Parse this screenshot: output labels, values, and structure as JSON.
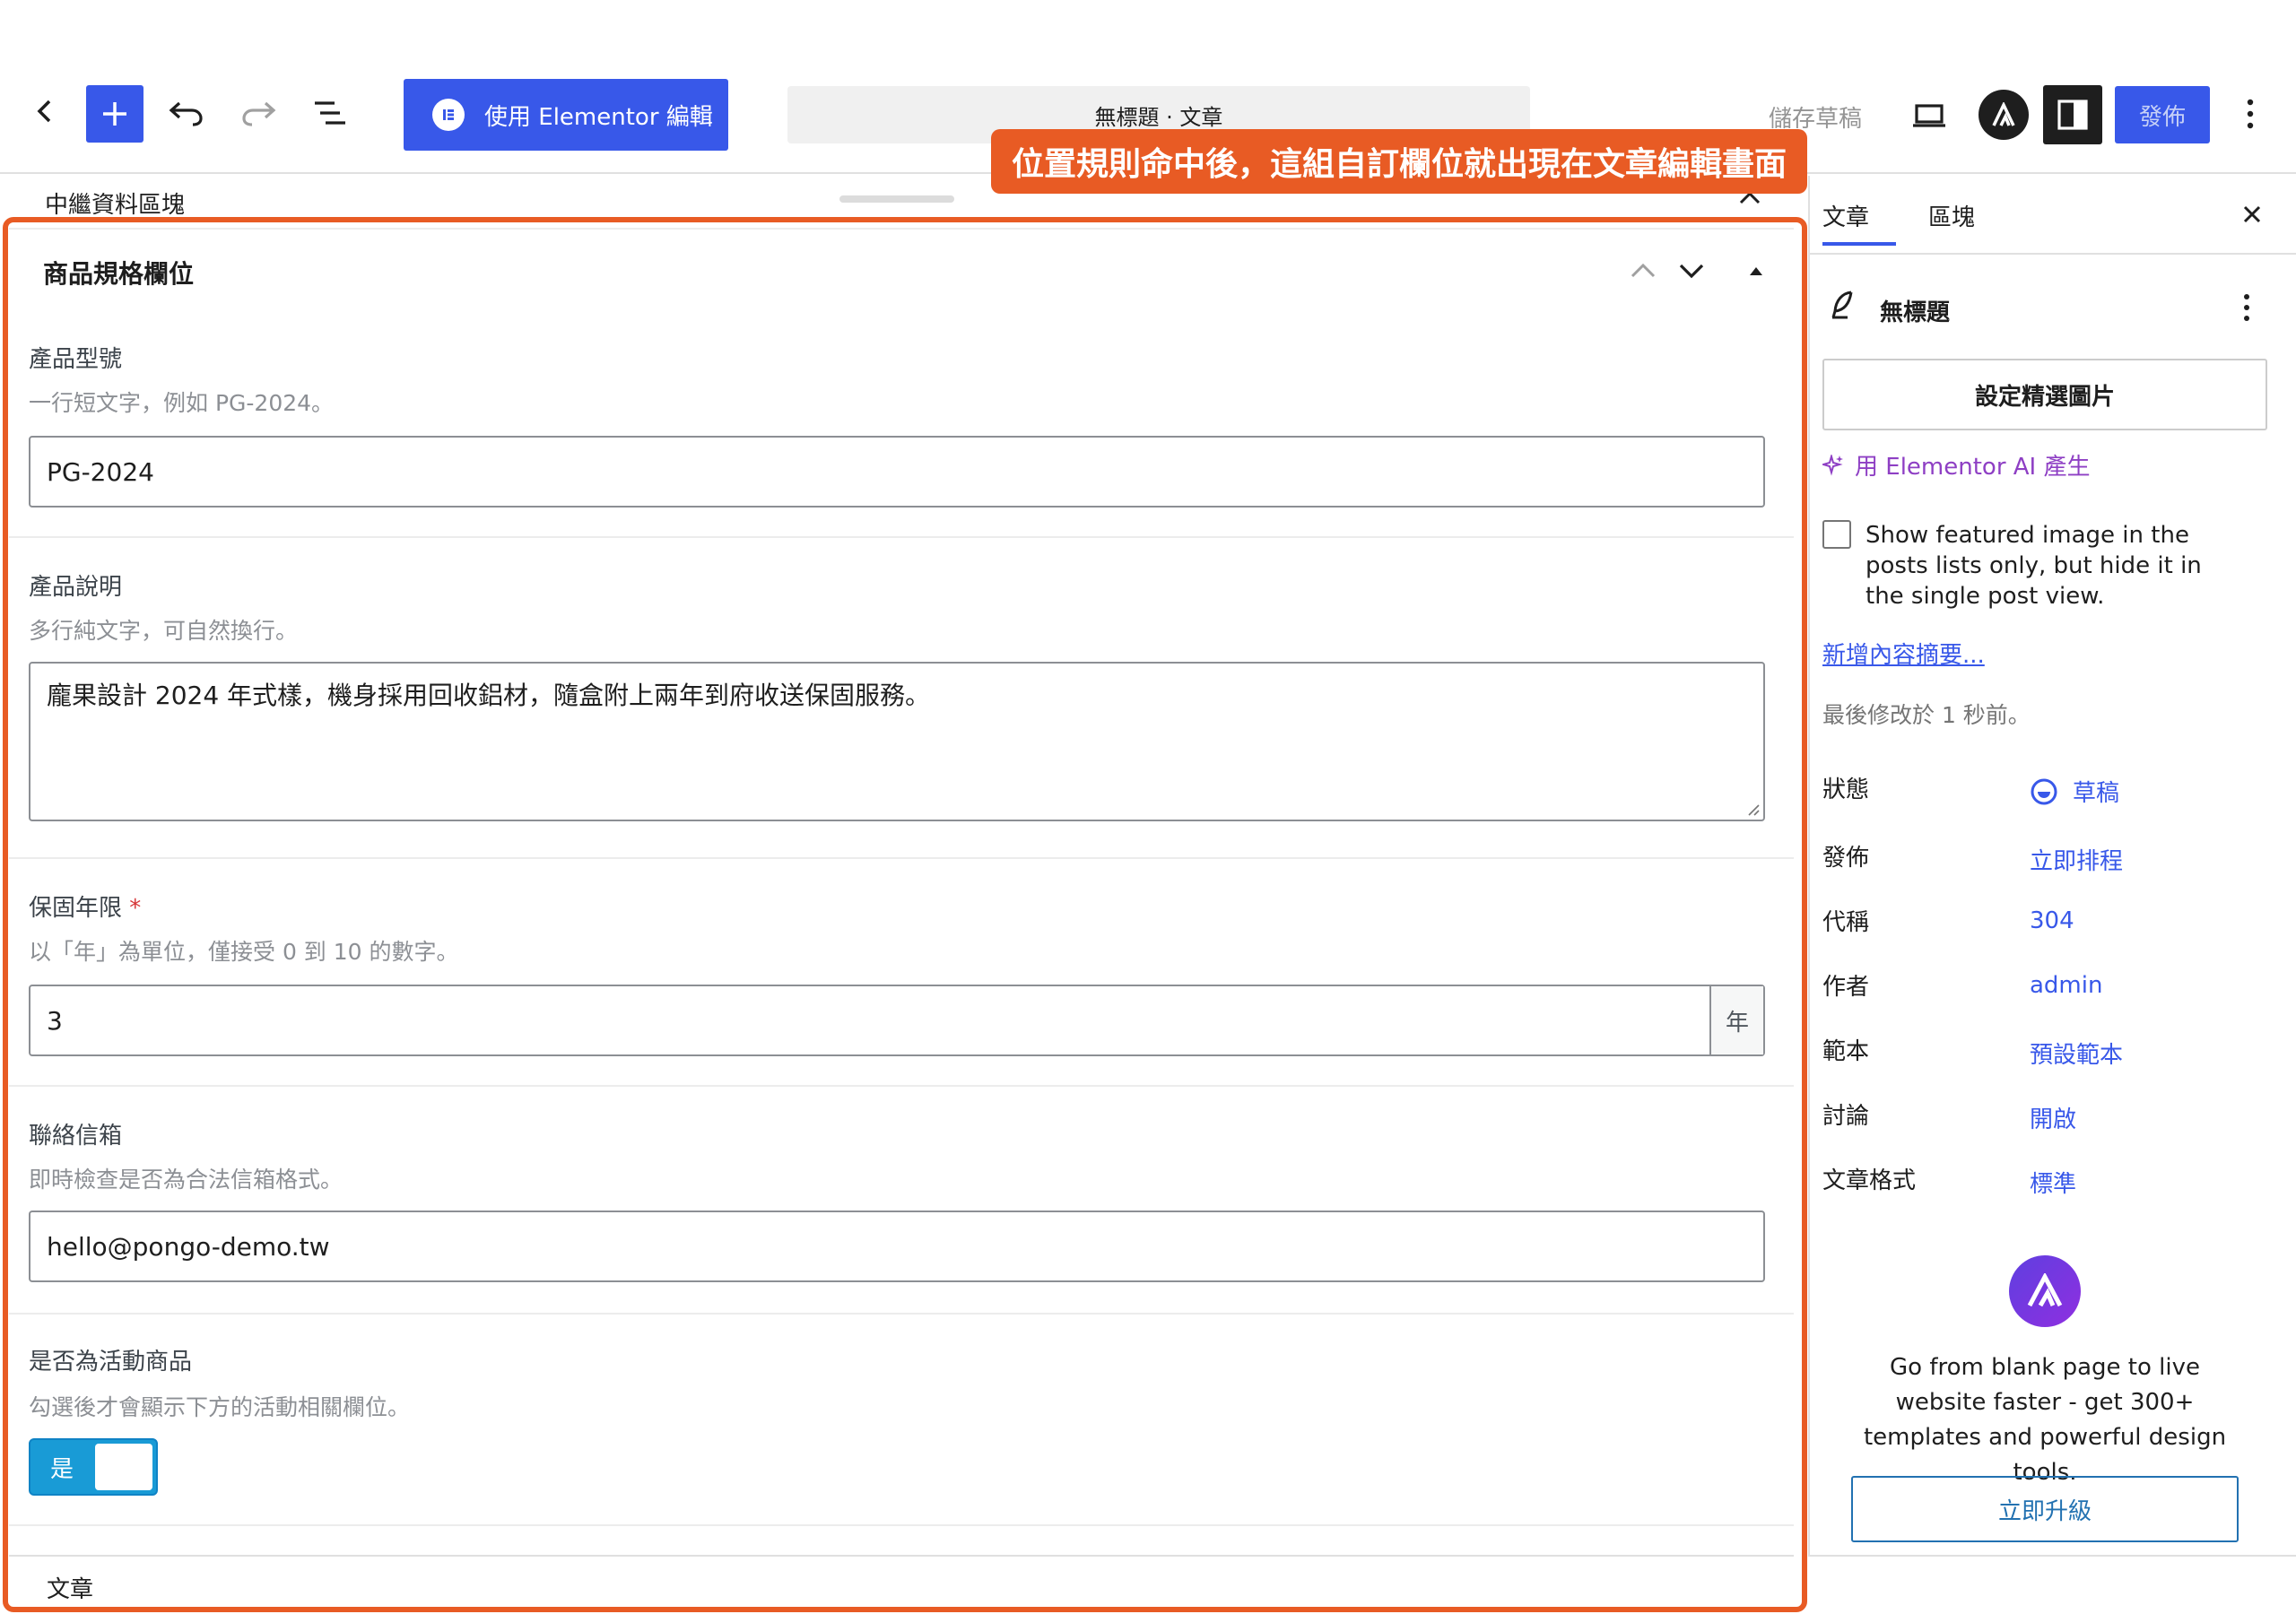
{
  "toolbar": {
    "elementor_button": "使用 Elementor 編輯",
    "document_title": "無標題 · 文章",
    "save_draft": "儲存草稿",
    "publish": "發佈"
  },
  "meta": {
    "header_label": "中繼資料區塊",
    "group_title": "商品規格欄位",
    "callout": "位置規則命中後，這組自訂欄位就出現在文章編輯畫面",
    "fields": [
      {
        "label": "產品型號",
        "description": "一行短文字，例如 PG-2024。",
        "value": "PG-2024"
      },
      {
        "label": "產品說明",
        "description": "多行純文字，可自然換行。",
        "value": "龐果設計 2024 年式樣，機身採用回收鋁材，隨盒附上兩年到府收送保固服務。"
      },
      {
        "label": "保固年限",
        "required_mark": "*",
        "description": "以「年」為單位，僅接受 0 到 10 的數字。",
        "value": "3",
        "append": "年"
      },
      {
        "label": "聯絡信箱",
        "description": "即時檢查是否為合法信箱格式。",
        "value": "hello@pongo-demo.tw"
      },
      {
        "label": "是否為活動商品",
        "description": "勾選後才會顯示下方的活動相關欄位。",
        "toggle_label": "是"
      }
    ],
    "bottom_label": "文章"
  },
  "sidebar": {
    "tabs": [
      "文章",
      "區塊"
    ],
    "post_title": "無標題",
    "featured_image_button": "設定精選圖片",
    "ai_link": "用 Elementor AI 產生",
    "checkbox_text": "Show featured image in the posts lists only, but hide it in the single post view.",
    "excerpt_link": "新增內容摘要...",
    "last_modified": "最後修改於 1 秒前。",
    "rows": [
      {
        "label": "狀態",
        "value": "草稿"
      },
      {
        "label": "發佈",
        "value": "立即排程"
      },
      {
        "label": "代稱",
        "value": "304"
      },
      {
        "label": "作者",
        "value": "admin"
      },
      {
        "label": "範本",
        "value": "預設範本"
      },
      {
        "label": "討論",
        "value": "開啟"
      },
      {
        "label": "文章格式",
        "value": "標準"
      }
    ],
    "promo_text": "Go from blank page to live website faster - get 300+ templates and powerful design tools.",
    "upgrade_button": "立即升級"
  },
  "colors": {
    "accent": "#3858e9",
    "highlight": "#e85b24",
    "toggle": "#199bd6"
  }
}
